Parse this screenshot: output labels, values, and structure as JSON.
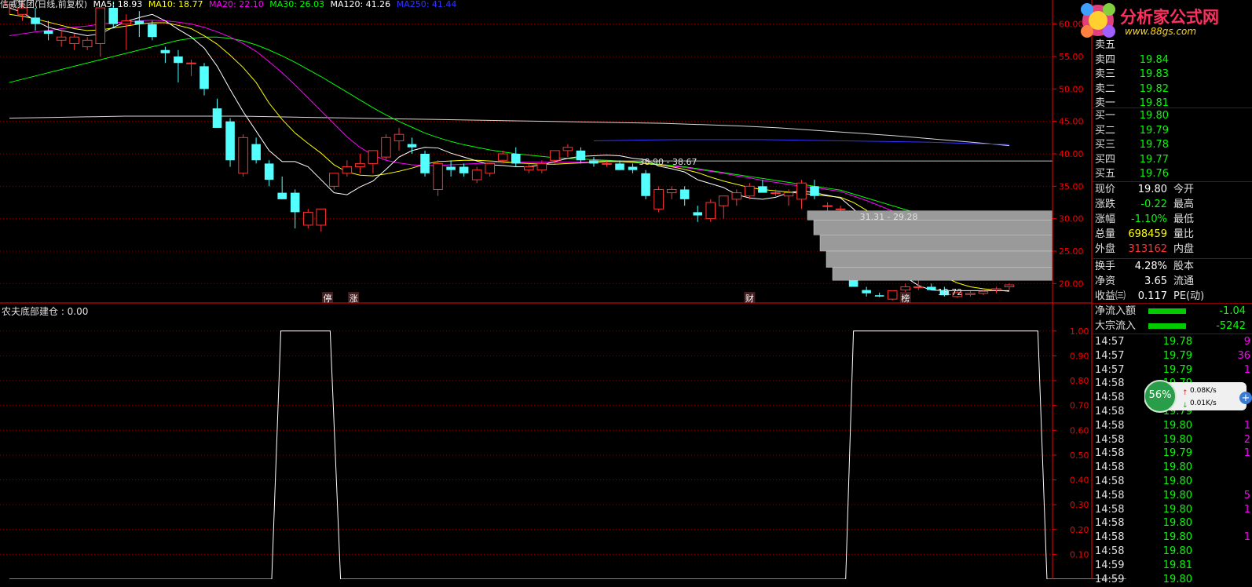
{
  "header": {
    "stock": "信威集团(日线,前复权)",
    "ma": [
      {
        "label": "MA5: 18.93",
        "color": "#ffffff"
      },
      {
        "label": "MA10: 18.77",
        "color": "#ffff00"
      },
      {
        "label": "MA20: 22.10",
        "color": "#ff00ff"
      },
      {
        "label": "MA30: 26.03",
        "color": "#00ff00"
      },
      {
        "label": "MA120: 41.26",
        "color": "#ffffff"
      },
      {
        "label": "MA250: 41.44",
        "color": "#3333ff"
      }
    ]
  },
  "logo": {
    "title": "分析家公式网",
    "url": "www.88gs.com"
  },
  "indicator": {
    "title": "农夫底部建仓 : 0.00"
  },
  "colors": {
    "up": "#ff3232",
    "down": "#54ffff",
    "grid": "#8b0000",
    "axis": "#ff0000"
  },
  "quote": {
    "asks": [
      {
        "label": "卖五",
        "price": ""
      },
      {
        "label": "卖四",
        "price": "19.84"
      },
      {
        "label": "卖三",
        "price": "19.83"
      },
      {
        "label": "卖二",
        "price": "19.82"
      },
      {
        "label": "卖一",
        "price": "19.81"
      }
    ],
    "bids": [
      {
        "label": "买一",
        "price": "19.80"
      },
      {
        "label": "买二",
        "price": "19.79"
      },
      {
        "label": "买三",
        "price": "19.78"
      },
      {
        "label": "买四",
        "price": "19.77"
      },
      {
        "label": "买五",
        "price": "19.76"
      }
    ],
    "stats": [
      {
        "label": "现价",
        "value": "19.80",
        "label2": "今开",
        "color": "#ffffff"
      },
      {
        "label": "涨跌",
        "value": "-0.22",
        "label2": "最高",
        "color": "#00ff00"
      },
      {
        "label": "涨幅",
        "value": "-1.10%",
        "label2": "最低",
        "color": "#00ff00"
      },
      {
        "label": "总量",
        "value": "698459",
        "label2": "量比",
        "color": "#ffff00"
      },
      {
        "label": "外盘",
        "value": "313162",
        "label2": "内盘",
        "color": "#ff3232"
      },
      {
        "label": "换手",
        "value": "4.28%",
        "label2": "股本",
        "color": "#ffffff"
      },
      {
        "label": "净资",
        "value": "3.65",
        "label2": "流通",
        "color": "#ffffff"
      },
      {
        "label": "收益㈢",
        "value": "0.117",
        "label2": "PE(动)",
        "color": "#ffffff"
      }
    ],
    "flow": [
      {
        "label": "净流入额",
        "value": "-1.04"
      },
      {
        "label": "大宗流入",
        "value": "-5242"
      }
    ]
  },
  "ticks": [
    {
      "time": "14:57",
      "price": "19.78",
      "vol": "9"
    },
    {
      "time": "14:57",
      "price": "19.79",
      "vol": "36"
    },
    {
      "time": "14:57",
      "price": "19.79",
      "vol": "1"
    },
    {
      "time": "14:58",
      "price": "19.79",
      "vol": ""
    },
    {
      "time": "14:58",
      "price": "19.79",
      "vol": ""
    },
    {
      "time": "14:58",
      "price": "19.79",
      "vol": ""
    },
    {
      "time": "14:58",
      "price": "19.80",
      "vol": "1"
    },
    {
      "time": "14:58",
      "price": "19.80",
      "vol": "2"
    },
    {
      "time": "14:58",
      "price": "19.79",
      "vol": "1"
    },
    {
      "time": "14:58",
      "price": "19.80",
      "vol": ""
    },
    {
      "time": "14:58",
      "price": "19.80",
      "vol": ""
    },
    {
      "time": "14:58",
      "price": "19.80",
      "vol": "5"
    },
    {
      "time": "14:58",
      "price": "19.80",
      "vol": "1"
    },
    {
      "time": "14:58",
      "price": "19.80",
      "vol": ""
    },
    {
      "time": "14:58",
      "price": "19.80",
      "vol": "1"
    },
    {
      "time": "14:58",
      "price": "19.80",
      "vol": ""
    },
    {
      "time": "14:59",
      "price": "19.81",
      "vol": ""
    },
    {
      "time": "14:59",
      "price": "19.80",
      "vol": ""
    }
  ],
  "speed": {
    "percent": "56%",
    "up": "0.08K/s",
    "down": "0.01K/s"
  },
  "chart_data": [
    {
      "type": "candlestick",
      "title": "信威集团(日线,前复权)",
      "ylim": [
        17.5,
        62.5
      ],
      "yticks": [
        20,
        25,
        30,
        35,
        40,
        45,
        50,
        55,
        60
      ],
      "candles": [
        [
          63.0,
          65.0,
          61.5,
          63.99
        ],
        [
          61.5,
          63.5,
          60.5,
          62.5
        ],
        [
          61.0,
          62.5,
          59.0,
          60.0
        ],
        [
          59.0,
          60.5,
          57.5,
          58.5
        ],
        [
          57.5,
          59.0,
          56.5,
          58.0
        ],
        [
          57.0,
          58.5,
          56.0,
          58.0
        ],
        [
          56.5,
          58.0,
          56.0,
          57.5
        ],
        [
          57.0,
          62.0,
          55.0,
          62.5
        ],
        [
          62.5,
          63.5,
          59.5,
          60.0
        ],
        [
          60.0,
          61.5,
          56.0,
          60.5
        ],
        [
          60.5,
          62.0,
          58.0,
          60.0
        ],
        [
          60.0,
          60.5,
          57.5,
          58.0
        ],
        [
          56.0,
          56.5,
          54.0,
          55.5
        ],
        [
          55.0,
          56.0,
          51.0,
          54.0
        ],
        [
          54.0,
          54.5,
          52.0,
          54.0
        ],
        [
          53.5,
          54.0,
          49.0,
          50.0
        ],
        [
          47.0,
          48.5,
          44.0,
          44.0
        ],
        [
          45.0,
          45.5,
          38.0,
          39.0
        ],
        [
          37.0,
          43.0,
          36.5,
          42.5
        ],
        [
          41.5,
          42.5,
          38.5,
          39.0
        ],
        [
          38.5,
          39.0,
          35.0,
          36.0
        ],
        [
          34.0,
          36.5,
          33.0,
          33.0
        ],
        [
          34.0,
          34.5,
          28.5,
          31.0
        ],
        [
          29.0,
          31.5,
          28.5,
          31.0
        ],
        [
          29.0,
          31.5,
          28.0,
          31.5
        ],
        [
          35.0,
          37.0,
          34.5,
          37.0
        ],
        [
          37.0,
          39.0,
          36.5,
          38.0
        ],
        [
          38.0,
          40.0,
          37.0,
          38.5
        ],
        [
          38.5,
          40.5,
          37.0,
          40.5
        ],
        [
          39.5,
          43.0,
          39.0,
          42.5
        ],
        [
          42.0,
          44.0,
          40.5,
          43.0
        ],
        [
          41.5,
          42.5,
          40.0,
          41.0
        ],
        [
          40.0,
          40.5,
          36.5,
          37.0
        ],
        [
          34.5,
          39.0,
          33.5,
          38.5
        ],
        [
          38.0,
          39.0,
          36.5,
          37.5
        ],
        [
          38.0,
          38.5,
          36.5,
          37.0
        ],
        [
          36.0,
          38.0,
          35.5,
          37.5
        ],
        [
          37.0,
          38.5,
          36.5,
          38.5
        ],
        [
          39.0,
          40.5,
          38.5,
          40.0
        ],
        [
          40.0,
          41.0,
          38.0,
          38.5
        ],
        [
          37.5,
          38.5,
          37.0,
          38.0
        ],
        [
          37.5,
          39.0,
          37.0,
          38.5
        ],
        [
          39.0,
          40.5,
          38.5,
          40.5
        ],
        [
          40.5,
          41.5,
          39.5,
          41.0
        ],
        [
          40.5,
          41.0,
          38.5,
          39.0
        ],
        [
          39.0,
          39.5,
          38.0,
          38.5
        ],
        [
          38.5,
          39.0,
          38.0,
          38.5
        ],
        [
          38.5,
          39.0,
          37.5,
          37.5
        ],
        [
          38.0,
          38.5,
          37.0,
          37.5
        ],
        [
          37.0,
          37.5,
          33.0,
          33.5
        ],
        [
          31.5,
          35.0,
          31.0,
          34.5
        ],
        [
          34.0,
          35.0,
          33.0,
          34.5
        ],
        [
          34.5,
          35.0,
          32.0,
          33.0
        ],
        [
          31.0,
          32.0,
          29.5,
          30.5
        ],
        [
          30.0,
          33.0,
          29.5,
          32.5
        ],
        [
          32.0,
          33.5,
          30.0,
          33.5
        ],
        [
          33.0,
          34.5,
          32.0,
          34.0
        ],
        [
          33.5,
          35.5,
          33.0,
          35.0
        ],
        [
          35.0,
          36.0,
          34.0,
          34.0
        ],
        [
          34.0,
          34.5,
          33.5,
          34.0
        ],
        [
          33.5,
          34.5,
          32.0,
          34.0
        ],
        [
          33.0,
          36.0,
          31.5,
          35.5
        ],
        [
          35.0,
          36.0,
          33.0,
          33.5
        ],
        [
          32.0,
          32.5,
          31.0,
          32.0
        ],
        [
          31.5,
          32.0,
          30.5,
          31.5
        ],
        [
          20.5,
          21.5,
          19.5,
          19.5
        ],
        [
          19.0,
          19.5,
          18.0,
          18.5
        ],
        [
          18.2,
          18.6,
          17.9,
          18.0
        ],
        [
          17.6,
          18.9,
          17.4,
          18.9
        ],
        [
          19.0,
          20.0,
          18.5,
          19.5
        ],
        [
          19.5,
          20.5,
          19.0,
          19.5
        ],
        [
          19.5,
          20.0,
          19.0,
          19.0
        ],
        [
          19.0,
          19.5,
          18.0,
          18.2
        ],
        [
          18.0,
          18.8,
          17.8,
          18.6
        ],
        [
          18.3,
          18.8,
          18.0,
          18.5
        ],
        [
          18.5,
          19.0,
          18.2,
          18.8
        ],
        [
          19.0,
          19.5,
          18.5,
          19.2
        ],
        [
          19.5,
          20.0,
          19.0,
          19.8
        ]
      ],
      "ma5": [
        62.5,
        61.8,
        60.5,
        59.5,
        59.0,
        58.6,
        58.2,
        58.5,
        59.5,
        60.4,
        61.0,
        61.5,
        60.5,
        59.2,
        58.0,
        56.3,
        53.5,
        49.9,
        46.5,
        43.5,
        40.5,
        38.8,
        38.8,
        38.0,
        36.0,
        34.0,
        33.7,
        34.9,
        35.8,
        37.6,
        39.5,
        40.5,
        41.0,
        40.9,
        40.1,
        39.5,
        38.9,
        38.3,
        38.2,
        38.0,
        38.0,
        38.3,
        38.8,
        39.3,
        39.6,
        39.7,
        39.8,
        39.7,
        39.3,
        39.1,
        38.1,
        37.7,
        37.2,
        36.0,
        35.4,
        34.8,
        33.7,
        33.2,
        33.0,
        33.3,
        34.0,
        34.3,
        34.0,
        33.6,
        33.2,
        31.5,
        29.5,
        26.3,
        23.0,
        21.0,
        19.7,
        19.0,
        18.9,
        18.9,
        18.9,
        18.9,
        18.9,
        18.9
      ],
      "ma10": [
        61.5,
        61.2,
        60.8,
        60.3,
        59.8,
        59.3,
        59.0,
        59.1,
        59.4,
        59.7,
        60.0,
        60.2,
        60.2,
        59.8,
        59.3,
        58.2,
        56.9,
        55.2,
        53.3,
        51.0,
        47.8,
        45.3,
        43.2,
        41.6,
        40.1,
        38.3,
        37.2,
        36.7,
        36.6,
        36.9,
        37.3,
        37.8,
        38.4,
        38.8,
        38.9,
        39.0,
        39.0,
        38.9,
        38.8,
        38.6,
        38.5,
        38.4,
        38.4,
        38.5,
        38.6,
        38.7,
        38.8,
        38.8,
        38.7,
        38.5,
        38.3,
        38.0,
        37.6,
        37.1,
        36.4,
        35.8,
        35.3,
        34.8,
        34.5,
        34.3,
        34.1,
        33.9,
        33.7,
        33.5,
        33.3,
        32.5,
        31.3,
        29.7,
        27.8,
        25.5,
        23.6,
        22.1,
        21.0,
        20.1,
        19.5,
        19.2,
        19.0,
        18.8
      ],
      "ma20": [
        58.2,
        58.5,
        58.8,
        59.0,
        59.3,
        59.5,
        59.7,
        60.0,
        60.2,
        60.3,
        60.5,
        60.6,
        60.5,
        60.3,
        60.0,
        59.5,
        58.8,
        58.0,
        57.0,
        55.8,
        54.2,
        52.5,
        50.6,
        48.6,
        46.6,
        44.6,
        42.6,
        41.0,
        39.8,
        39.0,
        38.6,
        38.3,
        38.2,
        38.2,
        38.3,
        38.4,
        38.5,
        38.6,
        38.6,
        38.7,
        38.7,
        38.7,
        38.7,
        38.7,
        38.7,
        38.7,
        38.8,
        38.8,
        38.7,
        38.5,
        38.3,
        38.1,
        37.9,
        37.6,
        37.3,
        37.0,
        36.6,
        36.3,
        35.9,
        35.6,
        35.3,
        35.0,
        34.8,
        34.5,
        34.2,
        33.5,
        32.8,
        32.0,
        31.2,
        30.3,
        29.4,
        28.5,
        27.5,
        26.5,
        25.5,
        24.5,
        23.5,
        22.2
      ],
      "ma30": [
        51.0,
        51.5,
        52.0,
        52.5,
        53.0,
        53.5,
        54.0,
        54.5,
        55.0,
        55.5,
        56.0,
        56.5,
        57.0,
        57.5,
        57.8,
        58.0,
        58.0,
        57.8,
        57.4,
        56.8,
        56.0,
        55.1,
        54.1,
        53.0,
        51.9,
        50.7,
        49.5,
        48.3,
        47.1,
        46.0,
        45.0,
        44.1,
        43.2,
        42.5,
        41.9,
        41.4,
        41.0,
        40.6,
        40.3,
        40.0,
        39.8,
        39.6,
        39.4,
        39.3,
        39.2,
        39.1,
        39.0,
        38.9,
        38.8,
        38.6,
        38.4,
        38.2,
        38.0,
        37.7,
        37.4,
        37.1,
        36.8,
        36.5,
        36.2,
        35.9,
        35.6,
        35.3,
        35.0,
        34.7,
        34.4,
        33.8,
        33.2,
        32.6,
        32.0,
        31.4,
        30.8,
        30.2,
        29.6,
        29.0,
        28.4,
        27.8,
        27.2,
        26.0
      ],
      "ma120_x0": 0.004,
      "ma120": [
        45.5,
        45.6,
        45.7,
        45.8,
        45.8,
        45.8,
        45.8,
        45.7,
        45.6,
        45.5,
        45.4,
        45.3,
        45.2,
        45.1,
        45.0,
        44.9,
        44.8,
        44.7,
        44.5,
        44.3,
        44.0,
        43.6,
        43.2,
        42.8,
        42.3,
        41.8,
        41.26
      ],
      "ma250_x0": 0.59,
      "ma250": [
        42.0,
        42.1,
        42.2,
        42.2,
        42.2,
        42.1,
        42.0,
        41.9,
        41.8,
        41.6,
        41.44
      ],
      "annotations": [
        {
          "text": "63.99",
          "x": 0,
          "y": 63.99
        },
        {
          "text": "38.90 - 38.67",
          "x": 48,
          "y": 38.8
        },
        {
          "text": "31.31 - 29.28",
          "x": 65,
          "y": 30.3
        },
        {
          "text": "18.72",
          "x": 71,
          "y": 18.72
        }
      ],
      "hline": 38.9,
      "volume_profile": [
        {
          "y0": 29.8,
          "y1": 31.2
        },
        {
          "y0": 27.5,
          "y1": 29.8
        },
        {
          "y0": 25.0,
          "y1": 27.5
        },
        {
          "y0": 22.5,
          "y1": 25.0
        },
        {
          "y0": 20.5,
          "y1": 22.5
        }
      ],
      "markers": [
        {
          "text": "停",
          "x": 24.5
        },
        {
          "text": "涨",
          "x": 26.5
        },
        {
          "text": "财",
          "x": 57
        },
        {
          "text": "榜",
          "x": 69
        }
      ]
    },
    {
      "type": "line",
      "title": "农夫底部建仓",
      "ylim": [
        0,
        1.05
      ],
      "yticks": [
        0.0,
        0.1,
        0.2,
        0.3,
        0.4,
        0.5,
        0.6,
        0.7,
        0.8,
        0.9,
        1.0
      ],
      "steps": [
        [
          0,
          0
        ],
        [
          20.2,
          0
        ],
        [
          20.9,
          1
        ],
        [
          24.7,
          1
        ],
        [
          25.5,
          0
        ],
        [
          64.4,
          0
        ],
        [
          65.0,
          1
        ],
        [
          79.2,
          1
        ],
        [
          79.9,
          0
        ],
        [
          86,
          0
        ]
      ]
    }
  ]
}
